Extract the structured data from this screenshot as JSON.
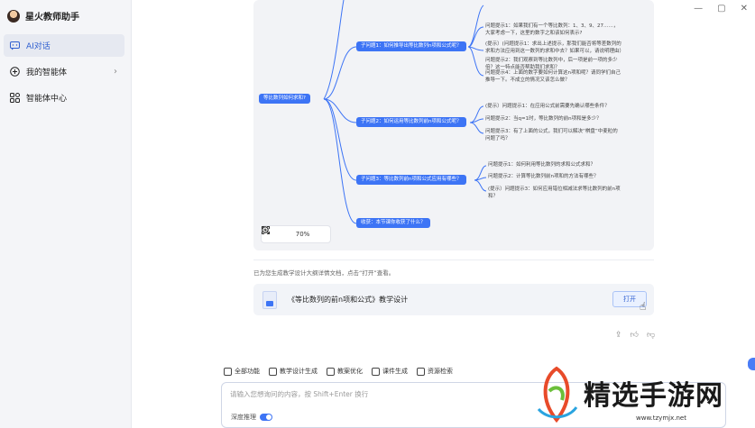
{
  "app": {
    "name": "星火教师助手"
  },
  "sidebar": {
    "items": [
      {
        "label": "AI对话",
        "icon": "chat-icon"
      },
      {
        "label": "我的智能体",
        "icon": "plus-circle-icon"
      },
      {
        "label": "智能体中心",
        "icon": "grid-icon"
      }
    ]
  },
  "window": {
    "minimize": "—",
    "restore": "▢",
    "close": "✕"
  },
  "mindmap": {
    "root": "等比数列如何求和?",
    "branches": [
      {
        "label": "子问题1：如何推导出等比数列n项和公式呢？",
        "leaves": [
          "问题提示1：如果我们有一个等比数列：1、3、9、27……，大家考虑一下，这里的数字之和该如何表示?",
          "(提示）(问题提示1：求出上述提示，那我们能否将等差数列的求和方法应用到这一数列的求和中去？如果可以，请说明理由）",
          "问题提示2：我们观察到等比数列中，后一项是前一项的多少倍？这一特点能否帮助我们求和？",
          "问题提示4：上面的数字要如何计算这n项和呢？请同学们自己推导一下。不成立的情况又该怎么做？"
        ]
      },
      {
        "label": "子问题2：如何运用等比数列前n项和公式呢？",
        "leaves": [
          "(提示）问题提示1：在应用公式前需要先确认哪些条件？",
          "问题提示2：当q=1时，等比数列的前n项和是多少？",
          "问题提示3：有了上面的公式，我们可以解决“棋盘”中麦粒的问题了吗？"
        ]
      },
      {
        "label": "子问题3：等比数列前n项和公式应用有哪些？",
        "leaves": [
          "问题提示1：如何利用等比数列的求和公式求和？",
          "问题提示2：计算等比数列前n项和的方法有哪些？",
          "(提示）问题提示3：如何应用错位相减法求等比数列的前n项和？"
        ]
      },
      {
        "label": "收获：本节课你收获了什么？",
        "leaves": []
      }
    ],
    "zoom": "70%"
  },
  "note": "已为您生成教学设计大纲详情文档，点击“打开”查看。",
  "doc": {
    "title": "《等比数列的前n项和公式》教学设计",
    "open_label": "打开"
  },
  "tools": [
    {
      "label": "全部功能",
      "icon": "apps-icon"
    },
    {
      "label": "教学设计生成",
      "icon": "lesson-plan-icon"
    },
    {
      "label": "教案优化",
      "icon": "optimize-icon"
    },
    {
      "label": "课件生成",
      "icon": "slides-icon"
    },
    {
      "label": "资源检索",
      "icon": "search-icon"
    }
  ],
  "input": {
    "placeholder": "请输入您想询问的内容，按 Shift+Enter 换行"
  },
  "deep_reasoning": {
    "label": "深度推理"
  },
  "watermark": {
    "title": "精选手游网",
    "url": "www.tzymjx.net"
  },
  "colors": {
    "accent": "#3d74f5",
    "sidebar_bg": "#f4f5f8",
    "map_bg": "#f2f3f6"
  }
}
